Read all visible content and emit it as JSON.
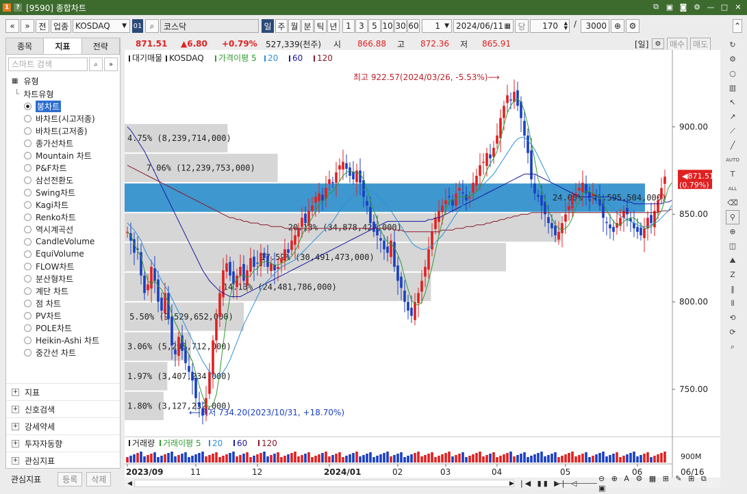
{
  "window": {
    "title": "[9590] 종합차트"
  },
  "toolbar": {
    "prev": "«",
    "next": "»",
    "jeon": "전",
    "category": "업종",
    "market": "KOSDAQ",
    "code": "01",
    "name": "코스닥",
    "periods": [
      "일",
      "주",
      "월",
      "분",
      "틱",
      "년"
    ],
    "minutes": [
      "1",
      "3",
      "5",
      "10",
      "30",
      "60"
    ],
    "interval": "1",
    "date": "2024/06/11",
    "count_label": "당",
    "count": "170",
    "total": "3000"
  },
  "price": {
    "current": "871.51",
    "change": "▲6.80",
    "change_pct": "+0.79%",
    "volume": "527,339(천주)",
    "open_label": "시",
    "open": "866.88",
    "high_label": "고",
    "high": "872.36",
    "low_label": "저",
    "low": "865.91",
    "period": "[일]",
    "buy": "매수",
    "sell": "매도"
  },
  "left": {
    "tabs": [
      "종목",
      "지표",
      "전략"
    ],
    "search_placeholder": "스마트 검색",
    "section": "유형",
    "tree_root": "차트유형",
    "chart_types": [
      "봉차트",
      "바차트(시고저종)",
      "바차트(고저종)",
      "종가선차트",
      "Mountain 차트",
      "P&F차트",
      "삼선전환도",
      "Swing차트",
      "Kagi차트",
      "Renko차트",
      "역시계곡선",
      "CandleVolume",
      "EquiVolume",
      "FLOW차트",
      "분산형차트",
      "계단 차트",
      "점 차트",
      "PV차트",
      "POLE차트",
      "Heikin-Ashi 차트",
      "중간선 차트"
    ],
    "bottom_sections": [
      "지표",
      "신호검색",
      "강세약세",
      "투자자동향",
      "관심지표"
    ],
    "fav_label": "관심지표",
    "register": "등록",
    "delete": "삭제"
  },
  "legend": {
    "items": [
      "대기매물",
      "KOSDAQ",
      "가격이평 5",
      "20",
      "60",
      "120"
    ]
  },
  "volume_legend": {
    "items": [
      "거래량",
      "거래이평 5",
      "20",
      "60",
      "120"
    ]
  },
  "annotations": {
    "high": "최고 922.57(2024/03/26, -5.53%)",
    "low": "최저 734.20(2023/10/31, +18.70%)"
  },
  "price_axis": {
    "labels": [
      "900.00",
      "850.00",
      "800.00",
      "750.00"
    ],
    "current": "871.51",
    "current_pct": "(0.79%)"
  },
  "volume_axis": {
    "label": "900M"
  },
  "time_axis": {
    "labels": [
      "2023/09",
      "11",
      "12",
      "2024/01",
      "02",
      "03",
      "04",
      "05",
      "06"
    ],
    "end": "06/16"
  },
  "colors": {
    "up": "#e02020",
    "down": "#1a3fc0",
    "ma5": "#2f9a2f",
    "ma20": "#2e8fd6",
    "ma60": "#1a1aa0",
    "ma120": "#8a1a2a",
    "highlight": "#3e97cf",
    "profile": "#cfcfcf"
  },
  "chart_data": {
    "type": "candlestick",
    "ylim": [
      725,
      940
    ],
    "volume_profile": [
      {
        "pct": "4.75%",
        "vol": "8,239,714,000",
        "low": 885,
        "high": 902
      },
      {
        "pct": "7.06%",
        "vol": "12,239,753,000",
        "low": 868,
        "high": 885
      },
      {
        "pct": "24.00%",
        "vol": "41,595,504,000",
        "low": 851,
        "high": 868
      },
      {
        "pct": "20.13%",
        "vol": "34,878,427,000",
        "low": 834,
        "high": 851
      },
      {
        "pct": "17.59%",
        "vol": "30,491,473,000",
        "low": 817,
        "high": 834
      },
      {
        "pct": "14.13%",
        "vol": "24,481,786,000",
        "low": 800,
        "high": 817
      },
      {
        "pct": "5.50%",
        "vol": "9,529,652,000",
        "low": 783,
        "high": 800
      },
      {
        "pct": "3.06%",
        "vol": "5,298,712,000",
        "low": 766,
        "high": 783
      },
      {
        "pct": "1.97%",
        "vol": "3,407,234,000",
        "low": 749,
        "high": 766
      },
      {
        "pct": "1.80%",
        "vol": "3,127,232,000",
        "low": 732,
        "high": 749
      }
    ],
    "highlighted_band": "24.00%",
    "closes": [
      840,
      835,
      828,
      830,
      815,
      805,
      810,
      820,
      812,
      800,
      795,
      805,
      790,
      775,
      770,
      780,
      772,
      765,
      760,
      755,
      745,
      740,
      735,
      745,
      760,
      778,
      790,
      805,
      818,
      822,
      815,
      810,
      815,
      820,
      812,
      818,
      825,
      820,
      822,
      828,
      825,
      820,
      822,
      818,
      820,
      825,
      830,
      828,
      835,
      838,
      842,
      848,
      845,
      852,
      855,
      860,
      862,
      858,
      865,
      870,
      868,
      874,
      878,
      880,
      876,
      872,
      870,
      875,
      868,
      860,
      855,
      845,
      840,
      838,
      835,
      830,
      828,
      835,
      820,
      812,
      808,
      800,
      795,
      792,
      800,
      805,
      812,
      820,
      830,
      840,
      848,
      852,
      855,
      858,
      860,
      855,
      862,
      865,
      862,
      858,
      860,
      868,
      872,
      878,
      880,
      885,
      882,
      888,
      895,
      905,
      912,
      918,
      915,
      920,
      912,
      905,
      895,
      885,
      870,
      862,
      860,
      855,
      850,
      845,
      842,
      838,
      840,
      845,
      850,
      855,
      860,
      862,
      865,
      868,
      862,
      858,
      862,
      860,
      855,
      848,
      845,
      842,
      840,
      845,
      848,
      852,
      850,
      846,
      842,
      840,
      838,
      842,
      848,
      845,
      852,
      858,
      865,
      871.51
    ],
    "ma5": [
      840,
      838,
      833,
      829,
      826,
      818,
      812,
      810,
      812,
      809,
      807,
      803,
      800,
      793,
      788,
      784,
      779,
      773,
      770,
      766,
      759,
      752,
      746,
      741,
      740,
      741,
      747,
      760,
      776,
      791,
      803,
      810,
      813,
      815,
      815,
      814,
      815,
      818,
      819,
      822,
      823,
      823,
      822,
      821,
      821,
      822,
      823,
      824,
      826,
      829,
      833,
      838,
      842,
      845,
      848,
      852,
      856,
      857,
      859,
      862,
      863,
      866,
      869,
      872,
      874,
      875,
      874,
      874,
      873,
      870,
      864,
      858,
      852,
      847,
      841,
      837,
      834,
      833,
      831,
      827,
      822,
      814,
      807,
      801,
      799,
      798,
      800,
      805,
      812,
      820,
      829,
      838,
      846,
      853,
      858,
      858,
      859,
      860,
      860,
      860,
      861,
      861,
      863,
      866,
      870,
      875,
      879,
      882,
      886,
      893,
      901,
      908,
      912,
      915,
      916,
      914,
      909,
      901,
      891,
      881,
      870,
      864,
      858,
      852,
      848,
      844,
      842,
      841,
      842,
      844,
      848,
      854,
      858,
      862,
      863,
      863,
      862,
      861,
      860,
      856,
      852,
      849,
      846,
      844,
      844,
      846,
      847,
      848,
      848,
      846,
      844,
      842,
      842,
      843,
      845,
      849,
      852,
      858,
      865,
      868
    ],
    "ma20": [
      845,
      843,
      841,
      838,
      835,
      830,
      826,
      823,
      820,
      816,
      812,
      809,
      806,
      802,
      798,
      794,
      790,
      786,
      782,
      778,
      774,
      770,
      766,
      763,
      760,
      758,
      757,
      758,
      760,
      763,
      767,
      772,
      777,
      782,
      787,
      791,
      795,
      799,
      803,
      807,
      810,
      812,
      814,
      816,
      818,
      820,
      821,
      822,
      823,
      824,
      826,
      828,
      830,
      832,
      834,
      836,
      838,
      840,
      842,
      844,
      846,
      849,
      852,
      855,
      857,
      859,
      861,
      862,
      863,
      864,
      864,
      863,
      862,
      861,
      859,
      857,
      855,
      852,
      849,
      846,
      843,
      840,
      837,
      834,
      832,
      831,
      830,
      830,
      831,
      832,
      834,
      836,
      838,
      841,
      844,
      847,
      850,
      853,
      855,
      857,
      859,
      861,
      863,
      865,
      867,
      869,
      871,
      873,
      876,
      879,
      882,
      885,
      888,
      891,
      893,
      894,
      894,
      892,
      890,
      887,
      883,
      879,
      875,
      871,
      867,
      863,
      860,
      858,
      856,
      855,
      855,
      855,
      856,
      857,
      858,
      859,
      860,
      860,
      859,
      858,
      857,
      855,
      853,
      851,
      849,
      848,
      847,
      846,
      845,
      844,
      843,
      843,
      843,
      844,
      845,
      846,
      848,
      850,
      852,
      855
    ],
    "ma60": [
      900,
      898,
      895,
      892,
      889,
      886,
      882,
      878,
      874,
      870,
      866,
      862,
      858,
      854,
      850,
      846,
      842,
      838,
      834,
      830,
      826,
      822,
      818,
      815,
      812,
      810,
      808,
      806,
      805,
      804,
      803,
      803,
      803,
      803,
      804,
      805,
      806,
      807,
      808,
      809,
      810,
      811,
      812,
      813,
      814,
      815,
      816,
      817,
      818,
      819,
      820,
      821,
      822,
      823,
      824,
      825,
      826,
      827,
      828,
      829,
      830,
      831,
      832,
      833,
      834,
      835,
      836,
      837,
      838,
      839,
      840,
      841,
      842,
      843,
      844,
      845,
      846,
      846,
      846,
      846,
      846,
      846,
      846,
      846,
      846,
      846,
      846,
      846,
      847,
      847,
      848,
      848,
      849,
      850,
      851,
      852,
      853,
      854,
      855,
      856,
      857,
      858,
      859,
      860,
      861,
      862,
      863,
      864,
      865,
      866,
      867,
      868,
      869,
      870,
      871,
      872,
      873,
      873,
      873,
      873,
      872,
      871,
      870,
      869,
      868,
      867,
      866,
      865,
      864,
      863,
      862,
      861,
      860,
      860,
      860,
      860,
      860,
      860,
      860,
      860,
      860,
      860,
      859,
      859,
      858,
      858,
      857,
      857,
      856,
      856,
      856,
      856,
      856,
      856,
      856,
      856,
      856,
      857,
      857,
      858
    ],
    "ma120": [
      878,
      877,
      876,
      875,
      874,
      873,
      872,
      871,
      870,
      869,
      868,
      867,
      866,
      865,
      864,
      863,
      862,
      861,
      860,
      859,
      858,
      857,
      856,
      855,
      854,
      853,
      852,
      851,
      850,
      849,
      848,
      848,
      847,
      847,
      846,
      846,
      845,
      845,
      845,
      844,
      844,
      844,
      843,
      843,
      843,
      843,
      842,
      842,
      842,
      842,
      842,
      842,
      842,
      842,
      842,
      842,
      842,
      842,
      842,
      842,
      842,
      842,
      842,
      842,
      842,
      842,
      842,
      842,
      842,
      842,
      842,
      842,
      842,
      842,
      842,
      842,
      842,
      842,
      841,
      841,
      841,
      840,
      840,
      840,
      840,
      840,
      840,
      840,
      840,
      840,
      840,
      840,
      841,
      841,
      841,
      841,
      842,
      842,
      842,
      843,
      843,
      843,
      844,
      844,
      844,
      845,
      845,
      846,
      846,
      847,
      847,
      848,
      848,
      849,
      849,
      850,
      850,
      850,
      851,
      851,
      851,
      851,
      851,
      851,
      851,
      851,
      851,
      851,
      851,
      851,
      851,
      851,
      851,
      851,
      851,
      851,
      851,
      851,
      851,
      851,
      851,
      851,
      851,
      851,
      851,
      851,
      851,
      851,
      851,
      851,
      851,
      851,
      851,
      851,
      851,
      851,
      852,
      852,
      852,
      853
    ]
  }
}
